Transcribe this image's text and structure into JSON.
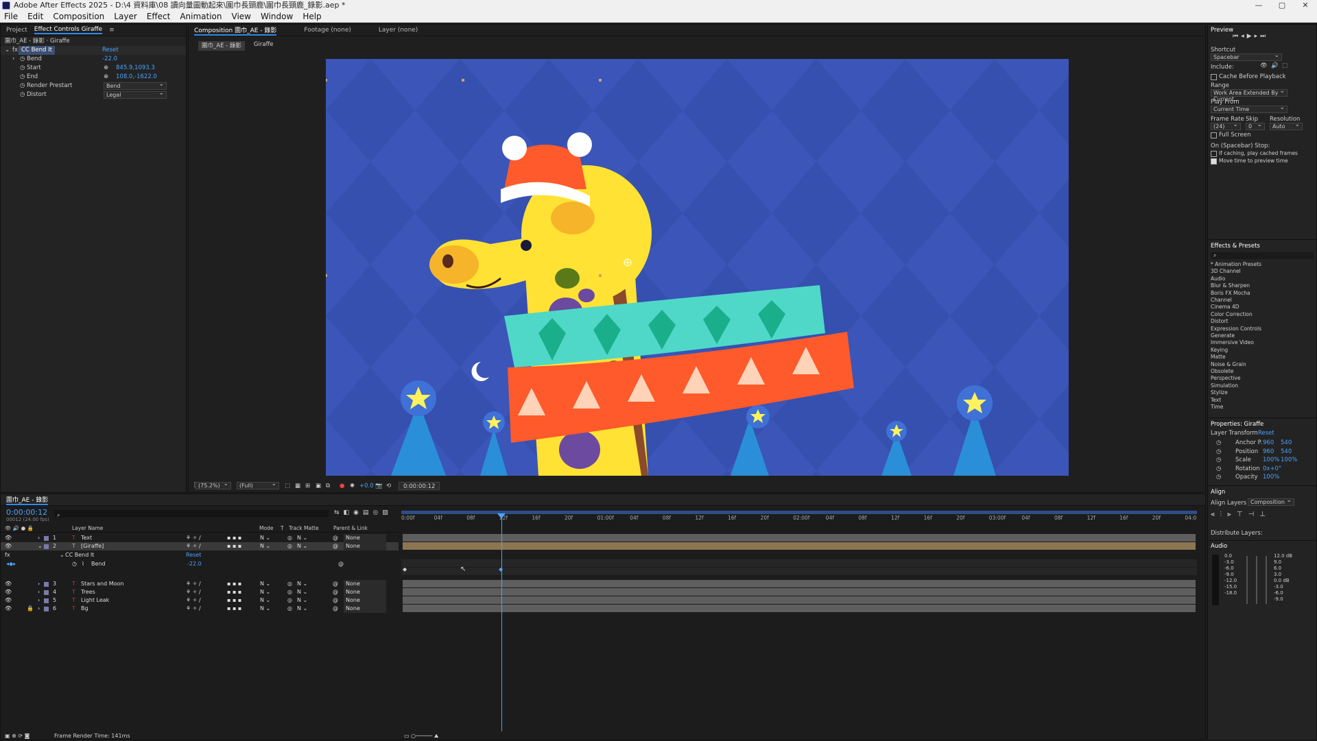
{
  "titlebar": {
    "title": "Adobe After Effects 2025 - D:\\4 資料庫\\08 讀向量圖動起來\\圍巾長頸鹿\\圍巾長頸鹿_錄影.aep *",
    "controls": [
      "—",
      "▢",
      "✕"
    ]
  },
  "menu": [
    "File",
    "Edit",
    "Composition",
    "Layer",
    "Effect",
    "Animation",
    "View",
    "Window",
    "Help"
  ],
  "left_panel": {
    "tabs": [
      "Project",
      "Effect Controls Giraffe"
    ],
    "breadcrumb": "圍巾_AE - 錄影 · Giraffe",
    "effect_name": "CC Bend It",
    "reset": "Reset",
    "props": [
      {
        "name": "Bend",
        "value": "-22.0"
      },
      {
        "name": "Start",
        "value": "845.9,1093.3"
      },
      {
        "name": "End",
        "value": "108.0,-1622.0"
      }
    ],
    "render_prestart": {
      "label": "Render Prestart",
      "value": "Bend"
    },
    "distort": {
      "label": "Distort",
      "value": "Legal"
    }
  },
  "comp_panel": {
    "tabs": [
      "Composition 圍巾_AE - 錄影",
      "Footage (none)",
      "Layer (none)"
    ],
    "subtabs": [
      "圍巾_AE - 錄影",
      "Giraffe"
    ],
    "zoom": "(75.2%)",
    "resolution": "(Full)",
    "exposure": "+0.0",
    "time": "0:00:00:12"
  },
  "preview": {
    "title": "Preview",
    "shortcut_label": "Shortcut",
    "shortcut": "Spacebar",
    "include": "Include:",
    "cache_before": "Cache Before Playback",
    "range_label": "Range",
    "range": "Work Area Extended By Current...",
    "playfrom_label": "Play From",
    "playfrom": "Current Time",
    "framerate_label": "Frame Rate",
    "skip_label": "Skip",
    "res_label": "Resolution",
    "framerate": "(24)",
    "skip": "0",
    "resolution": "Auto",
    "fullscreen": "Full Screen",
    "stop_label": "On (Spacebar) Stop:",
    "if_caching": "If caching, play cached frames",
    "move_time": "Move time to preview time"
  },
  "effects_presets": {
    "title": "Effects & Presets",
    "items": [
      "* Animation Presets",
      "3D Channel",
      "Audio",
      "Blur & Sharpen",
      "Boris FX Mocha",
      "Channel",
      "Cinema 4D",
      "Color Correction",
      "Distort",
      "Expression Controls",
      "Generate",
      "Immersive Video",
      "Keying",
      "Matte",
      "Noise & Grain",
      "Obsolete",
      "Perspective",
      "Simulation",
      "Stylize",
      "Text",
      "Time"
    ]
  },
  "properties": {
    "title": "Properties: Giraffe",
    "layer_transform": "Layer Transform",
    "reset": "Reset",
    "rows": [
      {
        "name": "Anchor P.",
        "v1": "960",
        "v2": "540"
      },
      {
        "name": "Position",
        "v1": "960",
        "v2": "540"
      },
      {
        "name": "Scale",
        "v1": "100%",
        "v2": "100%"
      },
      {
        "name": "Rotation",
        "v1": "0x+0°",
        "v2": ""
      },
      {
        "name": "Opacity",
        "v1": "100%",
        "v2": ""
      }
    ]
  },
  "align": {
    "title": "Align",
    "align_to_label": "Align Layers to:",
    "align_to": "Composition",
    "distribute": "Distribute Layers:"
  },
  "audio": {
    "title": "Audio",
    "left_scale": [
      "0.0",
      "-3.0",
      "-6.0",
      "-9.0",
      "-12.0",
      "-15.0",
      "-18.0"
    ],
    "right_scale": [
      "12.0 dB",
      "9.0",
      "6.0",
      "3.0",
      "0.0 dB",
      "-3.0",
      "-6.0",
      "-9.0"
    ]
  },
  "timeline": {
    "tab": "圍巾_AE - 錄影",
    "timecode": "0:00:00:12",
    "frames": "00012 (24.00 fps)",
    "headers": {
      "layer_name": "Layer Name",
      "mode": "Mode",
      "t": "T",
      "track_matte": "Track Matte",
      "parent": "Parent & Link"
    },
    "layers": [
      {
        "num": "1",
        "name": "Text",
        "parent": "None"
      },
      {
        "num": "2",
        "name": "[Giraffe]",
        "parent": "None"
      },
      {
        "num": "3",
        "name": "Stars and Moon",
        "parent": "None"
      },
      {
        "num": "4",
        "name": "Trees",
        "parent": "None"
      },
      {
        "num": "5",
        "name": "Light Leak",
        "parent": "None"
      },
      {
        "num": "6",
        "name": "Bg",
        "parent": "None"
      }
    ],
    "fx_name": "CC Bend It",
    "fx_reset": "Reset",
    "bend_label": "Bend",
    "bend_value": "-22.0",
    "ruler": [
      "0:00f",
      "04f",
      "08f",
      "12f",
      "16f",
      "20f",
      "01:00f",
      "04f",
      "08f",
      "12f",
      "16f",
      "20f",
      "02:00f",
      "04f",
      "08f",
      "12f",
      "16f",
      "20f",
      "03:00f",
      "04f",
      "08f",
      "12f",
      "16f",
      "20f",
      "04:0"
    ],
    "render_time": "Frame Render Time: 141ms"
  },
  "colors": {
    "accent": "#2d8ceb",
    "comp_bg": "#3b55b8",
    "giraffe": "#ffe234",
    "scarf_teal": "#4fd8c8",
    "scarf_red": "#ff5a2b"
  }
}
